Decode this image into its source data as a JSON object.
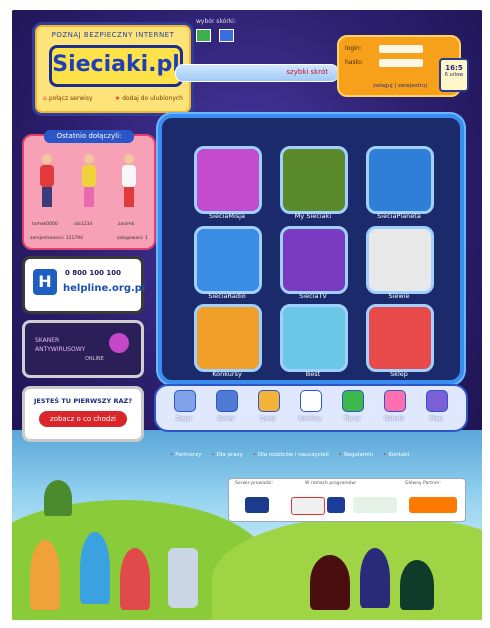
{
  "logo": {
    "tagline": "POZNAJ BEZPIECZNY INTERNET",
    "name": "Sieciaki.pl",
    "link_home": "połącz serwisy",
    "link_fav": "dodaj do ulubionych"
  },
  "skin": {
    "label": "wybór skórki:"
  },
  "quick_search": {
    "label": "szybki skrót"
  },
  "login": {
    "login_label": "login:",
    "password_label": "hasło:",
    "login_link": "zaloguj",
    "register_link": "zarejestruj",
    "time": "16:5",
    "day": "6 urlow"
  },
  "recent": {
    "title": "Ostatnio dołączyli:",
    "users": [
      "tomek0000",
      "ola1234",
      "zanimk"
    ],
    "registered": "zarejestrowani: 121794",
    "logged": "zalogowani: 1"
  },
  "helpline": {
    "phone": "0 800 100 100",
    "url": "helpline.org.pl"
  },
  "scanner": {
    "line1": "SKANER",
    "line2": "ANTYWIRUSOWY",
    "line3": "ONLINE"
  },
  "first_time": {
    "question": "JESTEŚ TU PIERWSZY RAZ?",
    "button": "zobacz o co chodzi"
  },
  "tiles": [
    {
      "label": "SieciaMisja",
      "color": "#c44ccf"
    },
    {
      "label": "My Sieciaki",
      "color": "#5b8a2a"
    },
    {
      "label": "SieciaPlaneta",
      "color": "#2f7fd8"
    },
    {
      "label": "SieciaRadio",
      "color": "#3a8ee6"
    },
    {
      "label": "SieciaTV",
      "color": "#7a3bc2"
    },
    {
      "label": "Siewie",
      "color": "#e8e8e8"
    },
    {
      "label": "Konkursy",
      "color": "#f0a029"
    },
    {
      "label": "Best",
      "color": "#6ac7e6"
    },
    {
      "label": "Sklep",
      "color": "#e84a4a"
    }
  ],
  "icons": [
    {
      "label": "Zegar",
      "color": "#7fa2e8"
    },
    {
      "label": "Sondy",
      "color": "#4f7bd6"
    },
    {
      "label": "Quizy",
      "color": "#f2b336"
    },
    {
      "label": "Komiksy",
      "color": "#ffffff"
    },
    {
      "label": "Tip so",
      "color": "#3db84a"
    },
    {
      "label": "Galeria",
      "color": "#ff6fb0"
    },
    {
      "label": "Mwp",
      "color": "#7a5fd6"
    }
  ],
  "footer_links": [
    "Partnerzy",
    "Dla prasy",
    "Dla rodziców i nauczycieli",
    "Regulamin",
    "Kontakt"
  ],
  "sponsors": {
    "h1": "Serwis prowadzi:",
    "h2": "W ramach programów:",
    "h3": "Główny Partner:",
    "logos": [
      "NASK",
      "EuroSafer",
      "EU",
      "dzieckointernet.pl",
      "Fundacja Orange"
    ]
  },
  "colors": {
    "accent": "#f7a11a",
    "brand": "#2d3f9a",
    "panel": "#1a2a6b"
  }
}
